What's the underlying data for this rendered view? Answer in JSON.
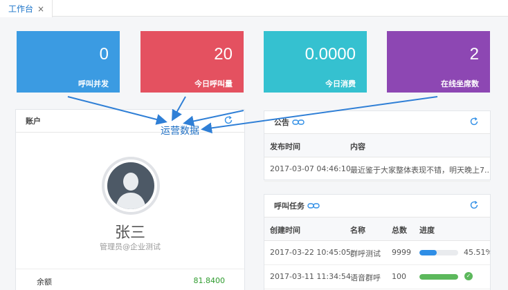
{
  "tab": {
    "label": "工作台",
    "close": "×"
  },
  "stats": [
    {
      "value": "0",
      "label": "呼叫并发",
      "color": "#3b9be2"
    },
    {
      "value": "20",
      "label": "今日呼叫量",
      "color": "#e45160"
    },
    {
      "value": "0.0000",
      "label": "今日消费",
      "color": "#35c1d0"
    },
    {
      "value": "2",
      "label": "在线坐席数",
      "color": "#8d47b3"
    }
  ],
  "account": {
    "title": "账户",
    "name": "张三",
    "role": "管理员@企业测试",
    "balance_label": "余额",
    "balance_value": "81.8400"
  },
  "annotation": "运营数据",
  "notice": {
    "title": "公告",
    "columns": [
      "发布时间",
      "内容"
    ],
    "rows": [
      {
        "time": "2017-03-07 04:46:10",
        "content": "最近鉴于大家整体表现不错，明天晚上7..."
      }
    ]
  },
  "tasks": {
    "title": "呼叫任务",
    "columns": [
      "创建时间",
      "名称",
      "总数",
      "进度"
    ],
    "rows": [
      {
        "time": "2017-03-22 10:45:05",
        "name": "群呼测试",
        "total": "9999",
        "progress": 0.4551,
        "progress_text": "45.51%",
        "bar_color": "#2f8ee6"
      },
      {
        "time": "2017-03-11 11:34:54",
        "name": "语音群呼",
        "total": "100",
        "progress": 1.0,
        "progress_text": "",
        "bar_color": "#5cb85c"
      }
    ]
  }
}
